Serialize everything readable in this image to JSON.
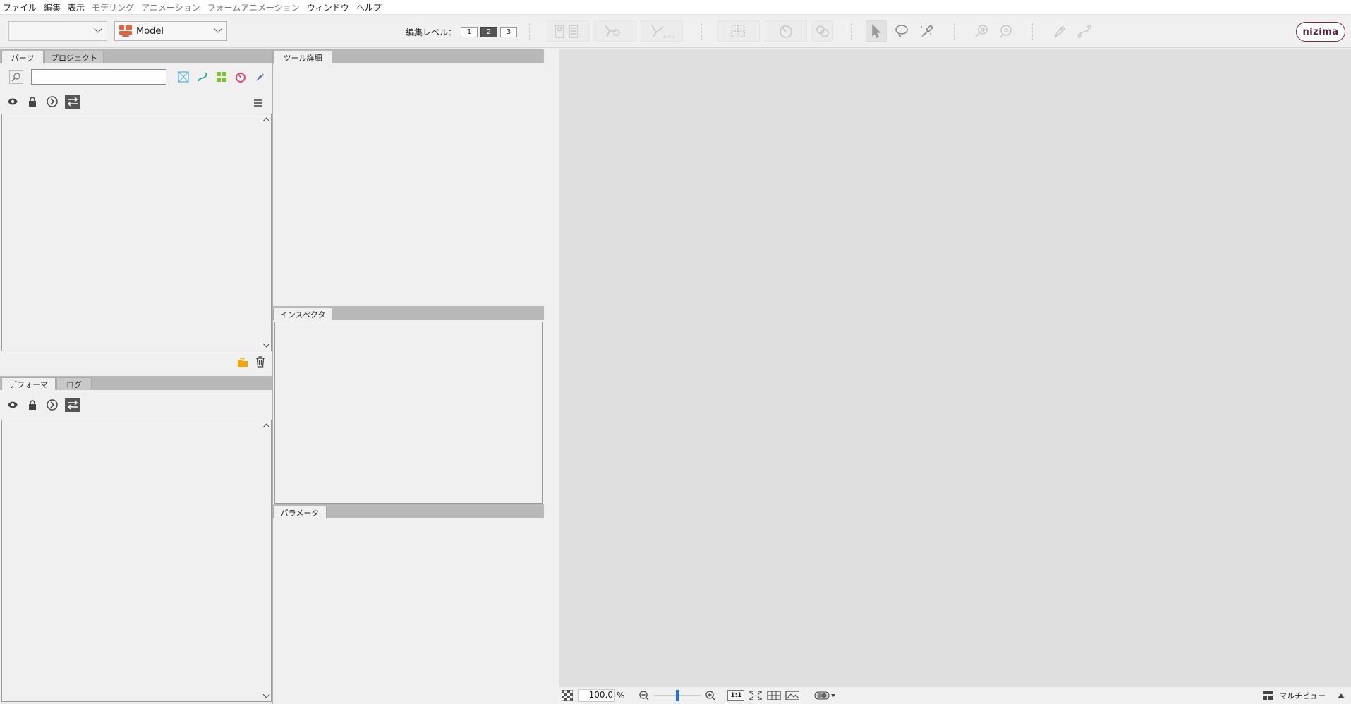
{
  "menu": [
    {
      "label": "ファイル",
      "enabled": true
    },
    {
      "label": "編集",
      "enabled": true
    },
    {
      "label": "表示",
      "enabled": true
    },
    {
      "label": "モデリング",
      "enabled": false
    },
    {
      "label": "アニメーション",
      "enabled": false
    },
    {
      "label": "フォームアニメーション",
      "enabled": false
    },
    {
      "label": "ウィンドウ",
      "enabled": true
    },
    {
      "label": "ヘルプ",
      "enabled": true
    }
  ],
  "toolbar": {
    "left_combo_value": "",
    "model_combo_value": "Model",
    "edit_level_label": "編集レベル：",
    "edit_levels": [
      "1",
      "2",
      "3"
    ],
    "active_edit_level": "2",
    "brand_label": "nizima",
    "brand_color": "#6b2c48"
  },
  "parts_panel": {
    "tabs": [
      "パーツ",
      "プロジェクト"
    ],
    "search_placeholder": "",
    "search_value": ""
  },
  "deformer_panel": {
    "tabs": [
      "デフォーマ",
      "ログ"
    ]
  },
  "tool_details_panel": {
    "tab": "ツール詳細"
  },
  "inspector_panel": {
    "tab": "インスペクタ"
  },
  "parameter_panel": {
    "tab": "パラメータ"
  },
  "statusbar": {
    "zoom_value": "100.0",
    "zoom_unit": "%",
    "zoom_slider_fraction": 0.5,
    "one_to_one_label": "1:1",
    "multiview_label": "マルチビュー"
  },
  "colors": {
    "accent_blue": "#1a78d8",
    "model_icon": "#e8603c",
    "folder_orange": "#f0a800"
  }
}
